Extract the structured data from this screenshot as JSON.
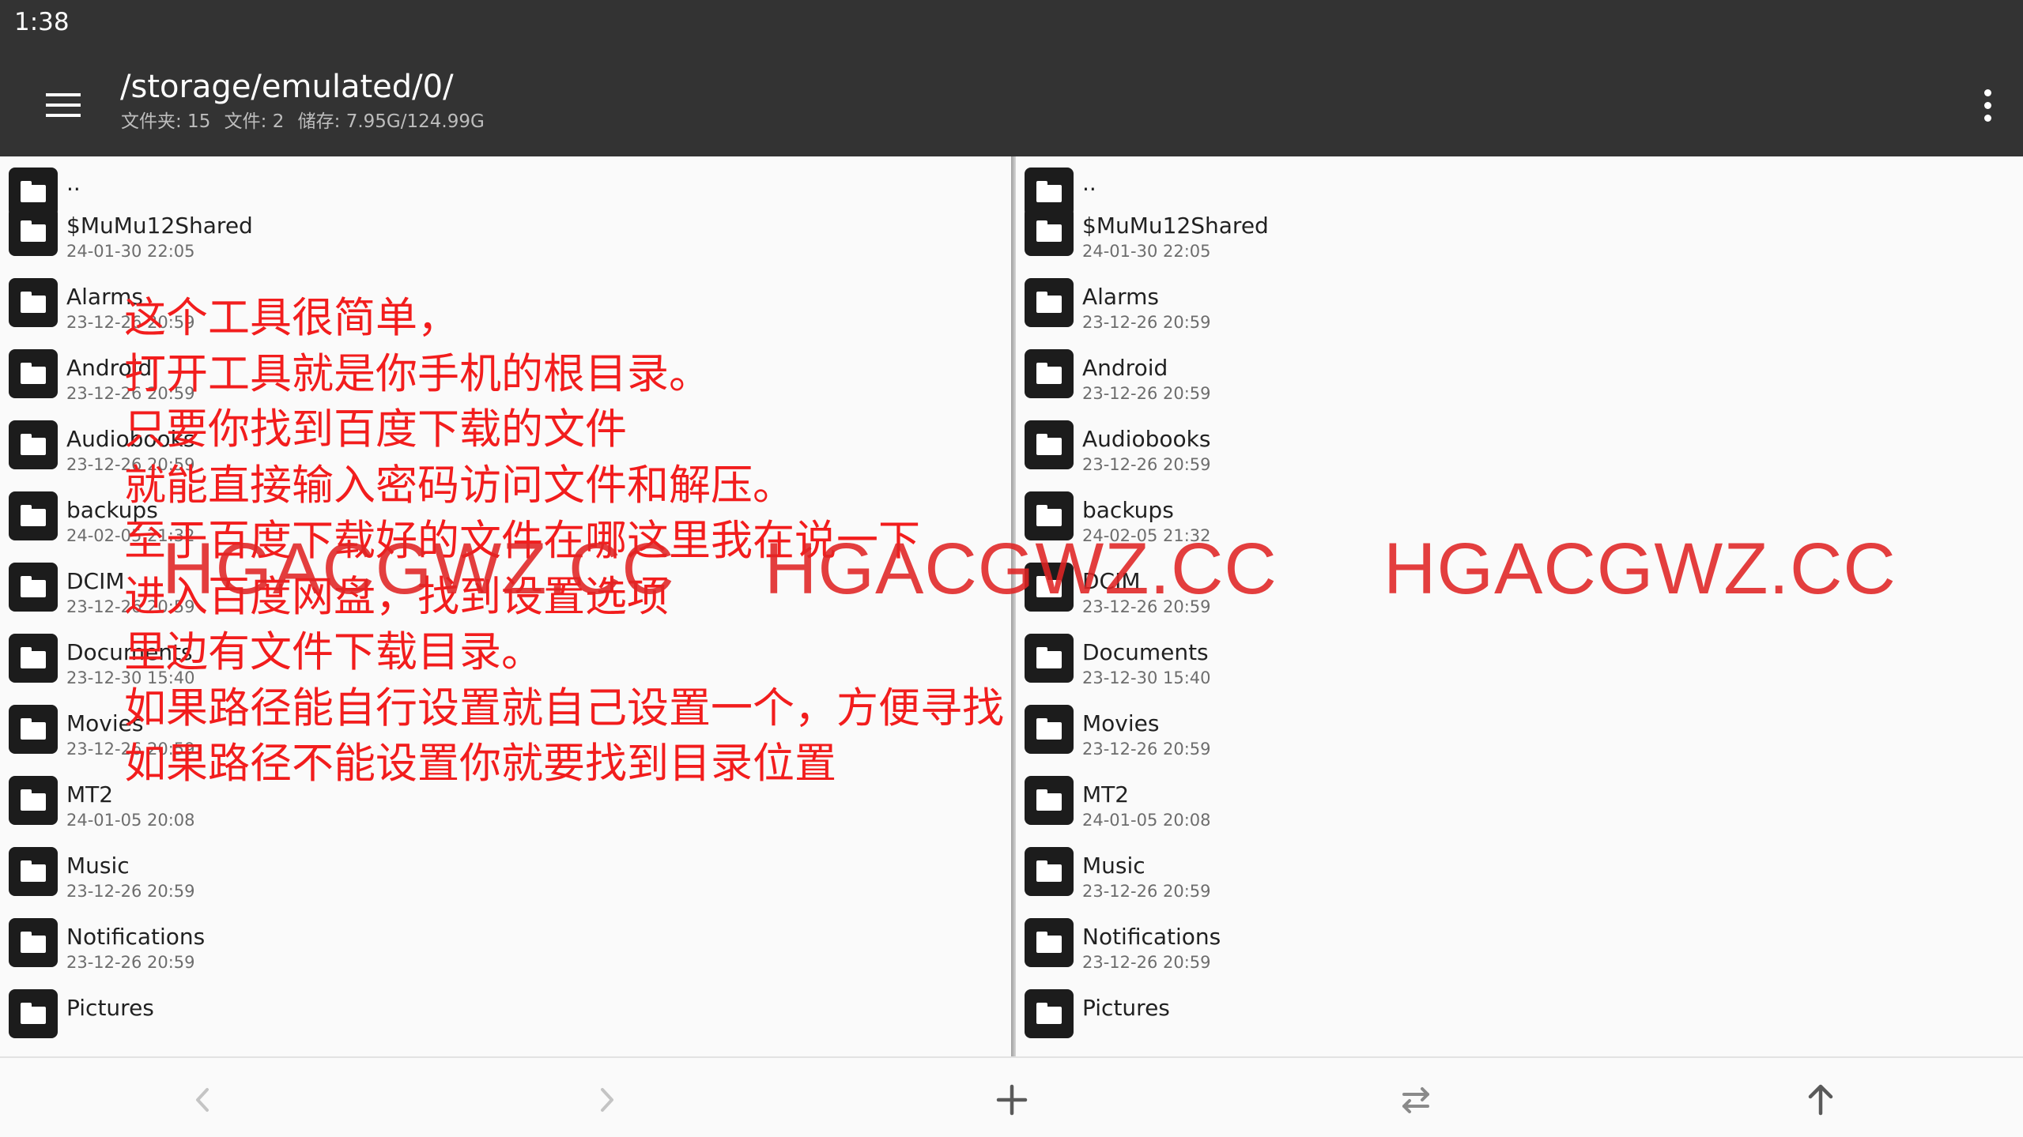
{
  "status_bar": {
    "time": "1:38"
  },
  "toolbar": {
    "path": "/storage/emulated/0/",
    "folders_label": "文件夹: 15",
    "files_label": "文件: 2",
    "storage_label": "储存: 7.95G/124.99G"
  },
  "left_pane": {
    "items": [
      {
        "name": "..",
        "date": ""
      },
      {
        "name": "$MuMu12Shared",
        "date": "24-01-30 22:05"
      },
      {
        "name": "Alarms",
        "date": "23-12-26 20:59"
      },
      {
        "name": "Android",
        "date": "23-12-26 20:59"
      },
      {
        "name": "Audiobooks",
        "date": "23-12-26 20:59"
      },
      {
        "name": "backups",
        "date": "24-02-05 21:32"
      },
      {
        "name": "DCIM",
        "date": "23-12-26 20:59"
      },
      {
        "name": "Documents",
        "date": "23-12-30 15:40"
      },
      {
        "name": "Movies",
        "date": "23-12-26 20:59"
      },
      {
        "name": "MT2",
        "date": "24-01-05 20:08"
      },
      {
        "name": "Music",
        "date": "23-12-26 20:59"
      },
      {
        "name": "Notifications",
        "date": "23-12-26 20:59"
      },
      {
        "name": "Pictures",
        "date": ""
      }
    ]
  },
  "right_pane": {
    "items": [
      {
        "name": "..",
        "date": ""
      },
      {
        "name": "$MuMu12Shared",
        "date": "24-01-30 22:05"
      },
      {
        "name": "Alarms",
        "date": "23-12-26 20:59"
      },
      {
        "name": "Android",
        "date": "23-12-26 20:59"
      },
      {
        "name": "Audiobooks",
        "date": "23-12-26 20:59"
      },
      {
        "name": "backups",
        "date": "24-02-05 21:32"
      },
      {
        "name": "DCIM",
        "date": "23-12-26 20:59"
      },
      {
        "name": "Documents",
        "date": "23-12-30 15:40"
      },
      {
        "name": "Movies",
        "date": "23-12-26 20:59"
      },
      {
        "name": "MT2",
        "date": "24-01-05 20:08"
      },
      {
        "name": "Music",
        "date": "23-12-26 20:59"
      },
      {
        "name": "Notifications",
        "date": "23-12-26 20:59"
      },
      {
        "name": "Pictures",
        "date": ""
      }
    ]
  },
  "overlay": {
    "lines": [
      "这个工具很简单，",
      "打开工具就是你手机的根目录。",
      "只要你找到百度下载的文件",
      "就能直接输入密码访问文件和解压。",
      "至于百度下载好的文件在哪这里我在说一下",
      "进入百度网盘，找到设置选项",
      "里边有文件下载目录。",
      "如果路径能自行设置就自己设置一个，方便寻找",
      "如果路径不能设置你就要找到目录位置"
    ],
    "watermarks": [
      "HGACGWZ.CC",
      "HGACGWZ.CC",
      "HGACGWZ.CC"
    ]
  },
  "icons": {
    "menu": "hamburger-menu-icon",
    "more": "more-vert-icon",
    "folder": "folder-icon",
    "back": "chevron-left-icon",
    "forward": "chevron-right-icon",
    "add": "plus-icon",
    "swap": "swap-icon",
    "up": "arrow-up-icon"
  },
  "colors": {
    "toolbar_bg": "#333333",
    "overlay_text": "#f21d1d",
    "disabled_icon": "#c4c4c4",
    "active_icon": "#5a5a5a"
  }
}
